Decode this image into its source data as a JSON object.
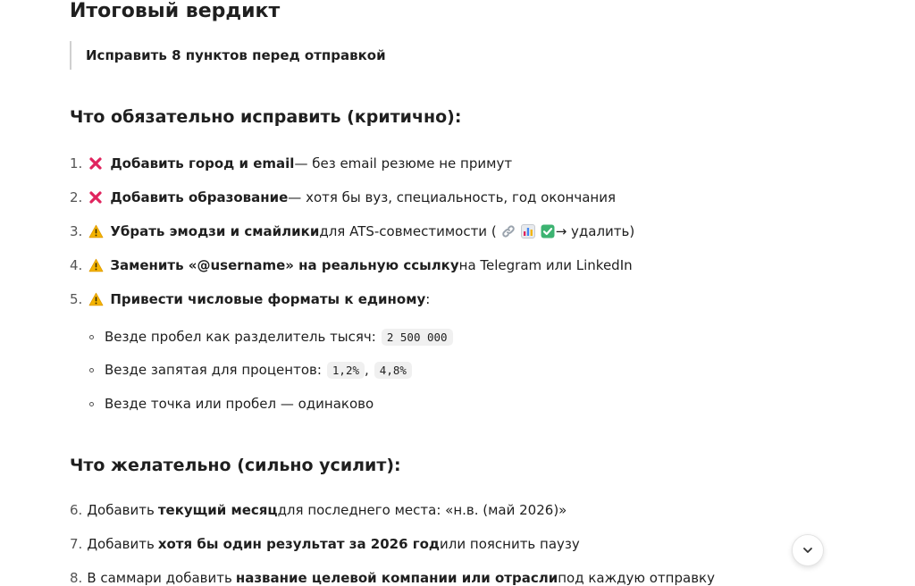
{
  "verdict": {
    "title": "Итоговый вердикт",
    "quote": "Исправить 8 пунктов перед отправкой"
  },
  "critical": {
    "heading": "Что обязательно исправить (критично):",
    "items": [
      {
        "num": "1.",
        "icon": "cross-mark-icon",
        "bold": "Добавить город и email",
        "rest": " — без email резюме не примут"
      },
      {
        "num": "2.",
        "icon": "cross-mark-icon",
        "bold": "Добавить образование",
        "rest": " — хотя бы вуз, специальность, год окончания"
      },
      {
        "num": "3.",
        "icon": "warning-icon",
        "bold": "Убрать эмодзи и смайлики",
        "rest": " для ATS-совместимости (",
        "rest_after": " → удалить)"
      },
      {
        "num": "4.",
        "icon": "warning-icon",
        "bold": "Заменить «@username» на реальную ссылку",
        "rest": " на Telegram или LinkedIn"
      },
      {
        "num": "5.",
        "icon": "warning-icon",
        "bold": "Привести числовые форматы к единому",
        "rest": ":"
      }
    ],
    "subitems": [
      {
        "text": "Везде пробел как разделитель тысяч:",
        "codes": [
          "2 500 000"
        ]
      },
      {
        "text": "Везде запятая для процентов:",
        "codes": [
          "1,2%",
          "4,8%"
        ],
        "separator": ","
      },
      {
        "text": "Везде точка или пробел — одинаково",
        "codes": []
      }
    ]
  },
  "desired": {
    "heading": "Что желательно (сильно усилит):",
    "items": [
      {
        "num": "6.",
        "pre": "Добавить ",
        "bold": "текущий месяц",
        "rest": " для последнего места: «н.в. (май 2026)»"
      },
      {
        "num": "7.",
        "pre": "Добавить ",
        "bold": "хотя бы один результат за 2026 год",
        "rest": " или пояснить паузу"
      },
      {
        "num": "8.",
        "pre": "В саммари добавить ",
        "bold": "название целевой компании или отрасли",
        "rest": " под каждую отправку"
      }
    ]
  },
  "colors": {
    "cross": "#e0245e",
    "warning": "#f4b400"
  }
}
